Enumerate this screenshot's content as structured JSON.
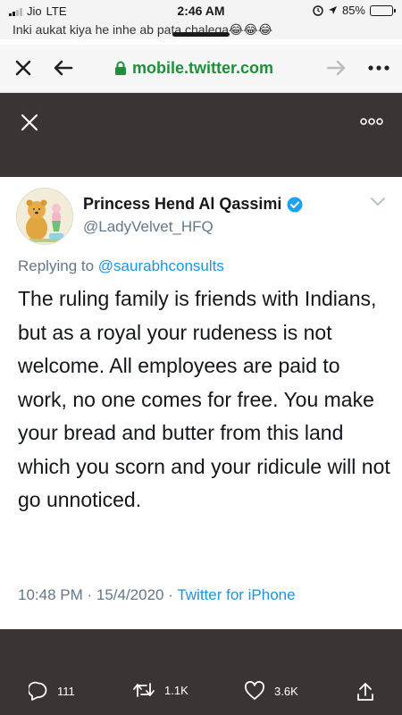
{
  "status_bar": {
    "carrier": "Jio",
    "network": "LTE",
    "time": "2:46 AM",
    "battery": "85%",
    "battery_fraction": 0.85
  },
  "notification": {
    "text": "Inki aukat kiya he inhe ab pata chalega😂😂😂"
  },
  "browser": {
    "url": "mobile.twitter.com",
    "icons": [
      "close-icon",
      "back-arrow-icon",
      "lock-icon",
      "forward-arrow-icon",
      "more-dots-icon"
    ]
  },
  "header": {
    "icons": [
      "close-icon",
      "more-options-icon"
    ]
  },
  "tweet": {
    "author_name": "Princess Hend Al Qassimi",
    "handle": "@LadyVelvet_HFQ",
    "replying_to_prefix": "Replying to",
    "replying_to_handle": "@saurabhconsults",
    "text": "The ruling family is friends with Indians, but as a royal your rudeness is not welcome. All employees are paid to work, no one comes for free. You make your bread and butter from this land which you scorn and your ridicule will not go unnoticed.",
    "timestamp": "10:48 PM · 15/4/2020 · ",
    "source": "Twitter for iPhone"
  },
  "actions": {
    "replies": "111",
    "retweets": "1.1K",
    "likes": "3.6K"
  },
  "colors": {
    "link_blue": "#1b95e0",
    "secure_green": "#1f8f3a",
    "dark_bar": "#3a3534",
    "verified_blue": "#1da1f2"
  }
}
